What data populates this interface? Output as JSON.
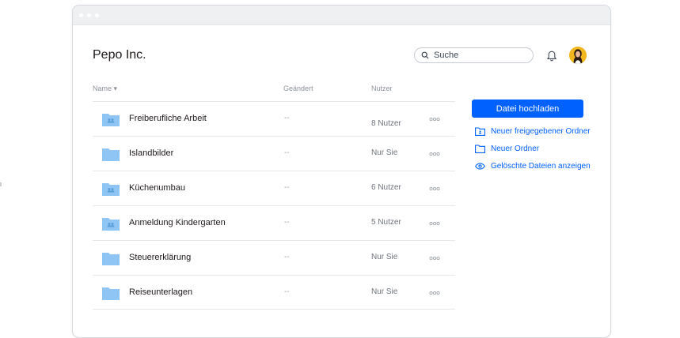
{
  "header": {
    "org_title": "Pepo Inc.",
    "search_placeholder": "Suche"
  },
  "table": {
    "columns": {
      "name": "Name ▾",
      "changed": "Geändert",
      "users": "Nutzer"
    },
    "rows": [
      {
        "name": "Freiberufliche Arbeit",
        "changed": "--",
        "users": "8 Nutzer",
        "icon": "shared-folder-icon"
      },
      {
        "name": "Islandbilder",
        "changed": "--",
        "users": "Nur Sie",
        "icon": "folder-icon"
      },
      {
        "name": "Küchenumbau",
        "changed": "--",
        "users": "6 Nutzer",
        "icon": "shared-folder-icon"
      },
      {
        "name": "Anmeldung Kindergarten",
        "changed": "--",
        "users": "5 Nutzer",
        "icon": "shared-folder-icon"
      },
      {
        "name": "Steuererklärung",
        "changed": "--",
        "users": "Nur Sie",
        "icon": "folder-icon"
      },
      {
        "name": "Reiseunterlagen",
        "changed": "--",
        "users": "Nur Sie",
        "icon": "folder-icon"
      }
    ]
  },
  "sidebar": {
    "upload_label": "Datei hochladen",
    "actions": [
      {
        "label": "Neuer freigegebener Ordner",
        "icon": "shared-folder-icon"
      },
      {
        "label": "Neuer Ordner",
        "icon": "folder-icon"
      },
      {
        "label": "Gelöschte Dateien anzeigen",
        "icon": "eye-icon"
      }
    ]
  },
  "colors": {
    "accent": "#0061fe",
    "folder": "#8ec5f5",
    "avatar_bg": "#f2b71f"
  }
}
